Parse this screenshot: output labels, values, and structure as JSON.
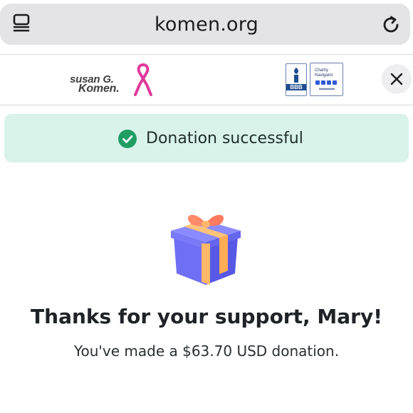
{
  "browser": {
    "url": "komen.org",
    "tabs_icon": "tabs-overview-icon",
    "reload_icon": "reload-icon"
  },
  "header": {
    "brand": {
      "line1": "susan G.",
      "line2": "Komen.",
      "ribbon_color": "#e0399b"
    },
    "badges": {
      "bbb": "BBB",
      "charity_navigator_line1": "Charity",
      "charity_navigator_line2": "Navigator"
    },
    "close_icon": "close-icon"
  },
  "banner": {
    "message": "Donation successful",
    "icon": "check-circle-icon",
    "background_color": "#d9f2ea",
    "icon_color": "#1f9d63"
  },
  "confirmation": {
    "icon": "gift-icon",
    "heading": "Thanks for your support, Mary!",
    "message": "You've made a $63.70 USD donation."
  }
}
